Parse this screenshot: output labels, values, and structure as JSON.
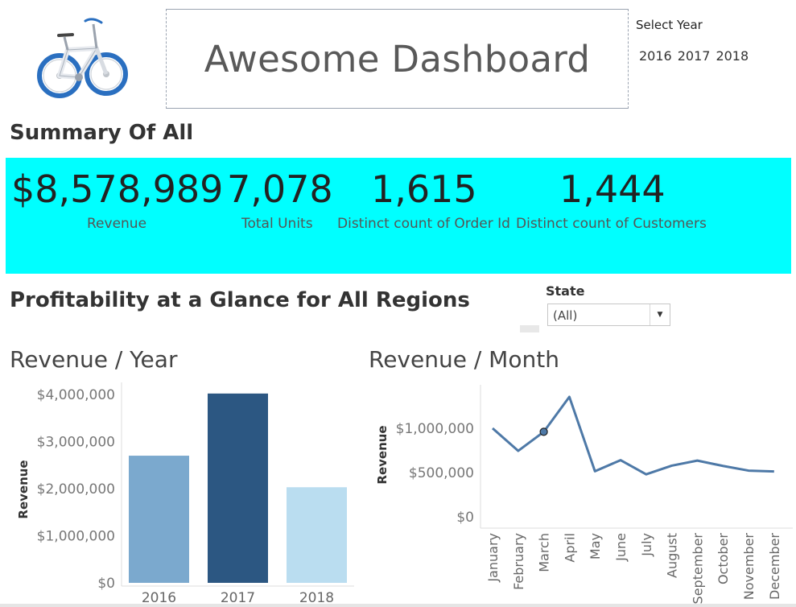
{
  "header": {
    "title": "Awesome Dashboard",
    "logo_icon": "bicycle-icon",
    "year_filter": {
      "label": "Select Year",
      "options": [
        "2016",
        "2017",
        "2018"
      ]
    }
  },
  "summary": {
    "title": "Summary Of All",
    "band_color": "#00FFFF",
    "kpis": [
      {
        "value": "$8,578,989",
        "label": "Revenue"
      },
      {
        "value": "7,078",
        "label": "Total Units"
      },
      {
        "value": "1,615",
        "label": "Distinct count of Order Id"
      },
      {
        "value": "1,444",
        "label": "Distinct count of Customers"
      }
    ]
  },
  "profitability": {
    "title": "Profitability at a Glance for All Regions",
    "state_filter": {
      "label": "State",
      "value": "(All)"
    }
  },
  "charts": {
    "year_title": "Revenue / Year",
    "month_title": "Revenue / Month"
  },
  "chart_data": [
    {
      "type": "bar",
      "title": "Revenue / Year",
      "categories": [
        "2016",
        "2017",
        "2018"
      ],
      "values": [
        2700000,
        4020000,
        2030000
      ],
      "colors": [
        "#7BA9CE",
        "#2C5782",
        "#BADDF0"
      ],
      "ylabel": "Revenue",
      "ylim": [
        0,
        4000000
      ],
      "yticks": [
        "$0",
        "$1,000,000",
        "$2,000,000",
        "$3,000,000",
        "$4,000,000"
      ],
      "grid": false
    },
    {
      "type": "line",
      "title": "Revenue / Month",
      "categories": [
        "January",
        "February",
        "March",
        "April",
        "May",
        "June",
        "July",
        "August",
        "September",
        "October",
        "November",
        "December"
      ],
      "values": [
        1000000,
        745000,
        960000,
        1355000,
        515000,
        640000,
        480000,
        578000,
        635000,
        575000,
        522000,
        512000
      ],
      "highlight_index": 2,
      "color": "#4E79A7",
      "ylabel": "Revenue",
      "ylim": [
        0,
        1400000
      ],
      "yticks": [
        "$0",
        "$500,000",
        "$1,000,000"
      ],
      "grid": false
    }
  ]
}
